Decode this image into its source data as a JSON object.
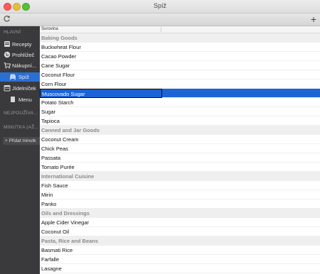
{
  "window": {
    "title": "Spíž"
  },
  "colors": {
    "sidebar_bg": "#3a3a3c",
    "selection": "#1c63d6",
    "group_bg": "#efefef",
    "close": "#fc5b57",
    "minimize": "#e5bf3c",
    "zoom": "#57c038"
  },
  "toolbar": {
    "refresh_icon": "refresh-icon",
    "add_label": "+"
  },
  "sidebar": {
    "section_main": "HLAVNÍ",
    "items": [
      {
        "label": "Recepty",
        "icon": "recipe-icon"
      },
      {
        "label": "Prohlížeč",
        "icon": "globe-icon"
      },
      {
        "label": "Nákupní...",
        "icon": "cart-icon"
      },
      {
        "label": "Spíž",
        "icon": "pantry-icon"
      },
      {
        "label": "Jídelníček",
        "icon": "calendar-icon"
      },
      {
        "label": "Menu",
        "icon": "menu-icon"
      }
    ],
    "section_unused": "NEJPOUŽÍVA...",
    "section_minute": "MINUTKA (AŽ...",
    "add_minute_label": "+ Přidat minutk"
  },
  "table": {
    "column_header": "Surovina",
    "rows": [
      {
        "type": "group",
        "text": "Baking Goods"
      },
      {
        "type": "item",
        "text": "Buckwheat Flour"
      },
      {
        "type": "item",
        "text": "Cacao Powder"
      },
      {
        "type": "item",
        "text": "Cane Sugar"
      },
      {
        "type": "item",
        "text": "Coconut Flour"
      },
      {
        "type": "item",
        "text": "Corn Flour"
      },
      {
        "type": "selected",
        "text": "Muscovado Sugar"
      },
      {
        "type": "item",
        "text": "Potato Starch"
      },
      {
        "type": "item",
        "text": "Sugar"
      },
      {
        "type": "item",
        "text": "Tapioca"
      },
      {
        "type": "group",
        "text": "Canned and Jar Goods"
      },
      {
        "type": "item",
        "text": "Coconut Cream"
      },
      {
        "type": "item",
        "text": "Chick Peas"
      },
      {
        "type": "item",
        "text": "Passata"
      },
      {
        "type": "item",
        "text": "Tomato Purée"
      },
      {
        "type": "group",
        "text": "International Cuisine"
      },
      {
        "type": "item",
        "text": "Fish Sauce"
      },
      {
        "type": "item",
        "text": "Mirin"
      },
      {
        "type": "item",
        "text": "Panko"
      },
      {
        "type": "group",
        "text": "Oils and Dressings"
      },
      {
        "type": "item",
        "text": "Apple Cider Vinegar"
      },
      {
        "type": "item",
        "text": "Coconut Oil"
      },
      {
        "type": "group",
        "text": "Pasta, Rice and Beans"
      },
      {
        "type": "item",
        "text": "Basmati Rice"
      },
      {
        "type": "item",
        "text": "Farfalle"
      },
      {
        "type": "item",
        "text": "Lasagne"
      }
    ]
  }
}
